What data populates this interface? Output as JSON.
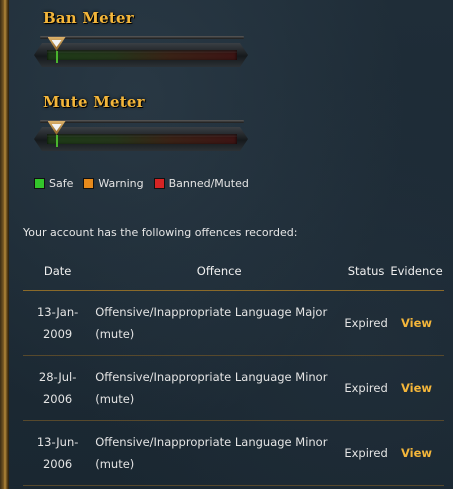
{
  "ban_meter": {
    "title": "Ban Meter",
    "level": 0.05
  },
  "mute_meter": {
    "title": "Mute Meter",
    "level": 0.05
  },
  "legend": [
    {
      "label": "Safe",
      "color": "#33c52b"
    },
    {
      "label": "Warning",
      "color": "#e68a1c"
    },
    {
      "label": "Banned/Muted",
      "color": "#d62424"
    }
  ],
  "intro_text": "Your account has the following offences recorded:",
  "table": {
    "headers": {
      "date": "Date",
      "offence": "Offence",
      "status": "Status",
      "evidence": "Evidence"
    },
    "rows": [
      {
        "date_line1": "13-Jan-",
        "date_line2": "2009",
        "offence_line1": "Offensive/Inappropriate Language Major",
        "offence_line2": "(mute)",
        "status": "Expired",
        "evidence": "View"
      },
      {
        "date_line1": "28-Jul-",
        "date_line2": "2006",
        "offence_line1": "Offensive/Inappropriate Language Minor",
        "offence_line2": "(mute)",
        "status": "Expired",
        "evidence": "View"
      },
      {
        "date_line1": "13-Jun-",
        "date_line2": "2006",
        "offence_line1": "Offensive/Inappropriate Language Minor",
        "offence_line2": "(mute)",
        "status": "Expired",
        "evidence": "View"
      }
    ]
  }
}
